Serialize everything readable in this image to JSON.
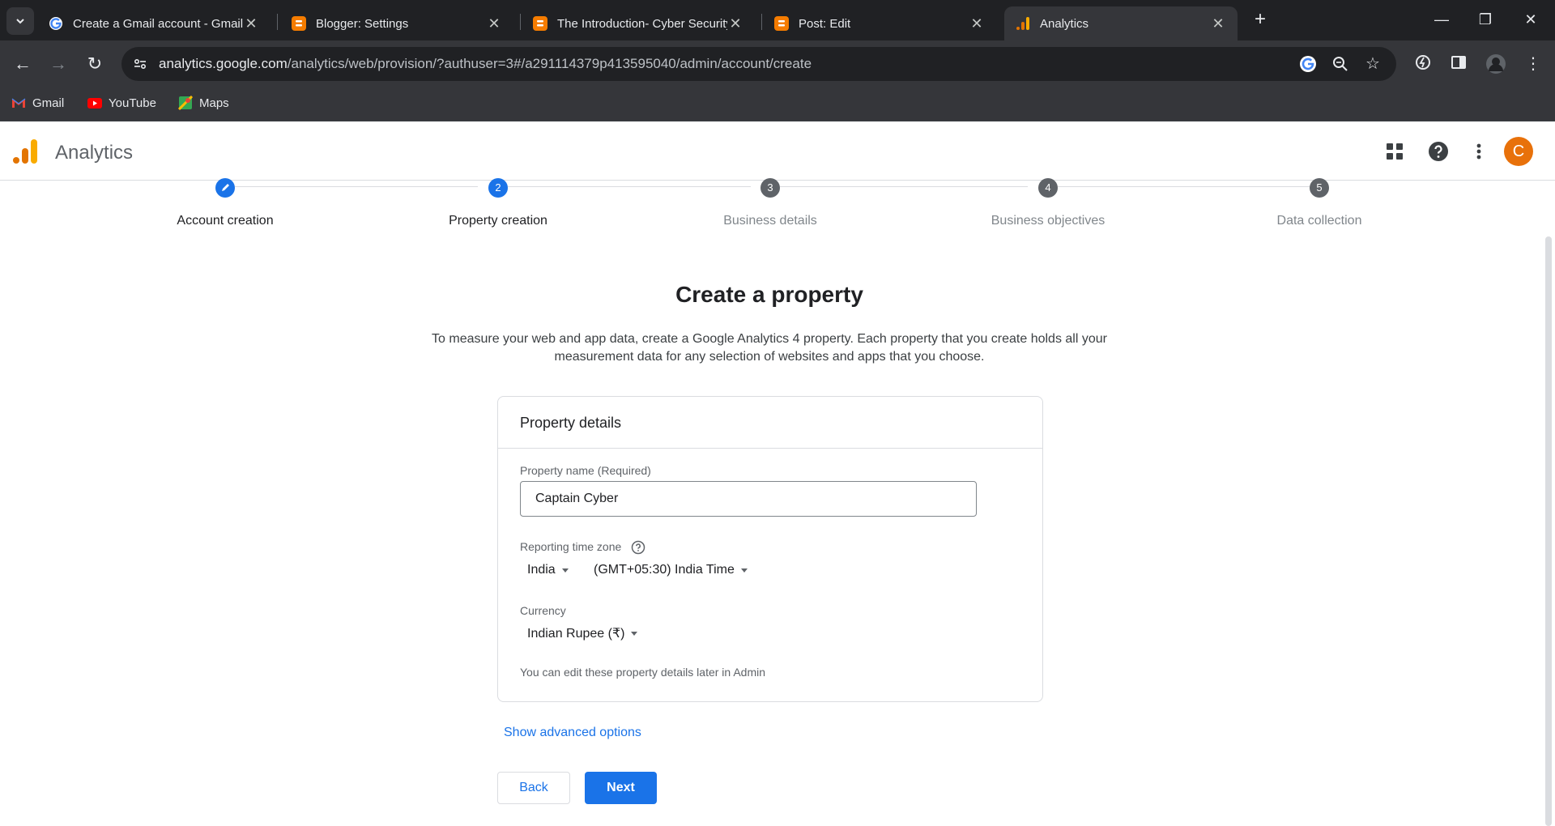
{
  "browser": {
    "tabs": [
      {
        "title": "Create a Gmail account - Gmail",
        "icon": "google-icon"
      },
      {
        "title": "Blogger: Settings",
        "icon": "blogger-icon"
      },
      {
        "title": "The Introduction- Cyber Security",
        "icon": "blogger-icon"
      },
      {
        "title": "Post: Edit",
        "icon": "blogger-icon"
      },
      {
        "title": "Analytics",
        "icon": "analytics-icon"
      }
    ],
    "url_host": "analytics.google.com",
    "url_path": "/analytics/web/provision/?authuser=3#/a291114379p413595040/admin/account/create",
    "bookmarks": [
      {
        "label": "Gmail"
      },
      {
        "label": "YouTube"
      },
      {
        "label": "Maps"
      }
    ]
  },
  "app": {
    "title": "Analytics",
    "avatar_letter": "C",
    "accent": "#1a73e8"
  },
  "stepper": {
    "steps": [
      {
        "number": "",
        "label": "Account creation",
        "state": "done"
      },
      {
        "number": "2",
        "label": "Property creation",
        "state": "current"
      },
      {
        "number": "3",
        "label": "Business details",
        "state": "pending"
      },
      {
        "number": "4",
        "label": "Business objectives",
        "state": "pending"
      },
      {
        "number": "5",
        "label": "Data collection",
        "state": "pending"
      }
    ]
  },
  "main": {
    "title": "Create a property",
    "description_line1": "To measure your web and app data, create a Google Analytics 4 property. Each property that you create holds all your",
    "description_line2": "measurement data for any selection of websites and apps that you choose.",
    "card": {
      "heading": "Property details",
      "property_name_label": "Property name (Required)",
      "property_name_value": "Captain Cyber",
      "timezone_label": "Reporting time zone",
      "country_value": "India",
      "timezone_value": "(GMT+05:30) India Time",
      "currency_label": "Currency",
      "currency_value": "Indian Rupee (₹)",
      "hint": "You can edit these property details later in Admin"
    },
    "advanced_link": "Show advanced options",
    "back_label": "Back",
    "next_label": "Next"
  }
}
